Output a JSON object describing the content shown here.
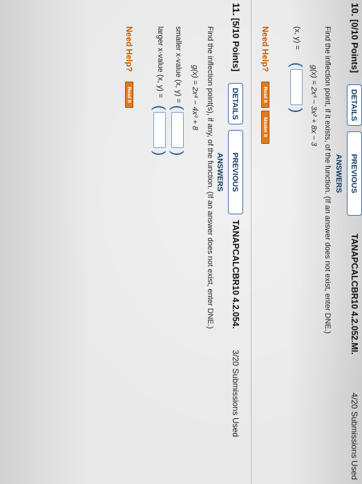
{
  "q10": {
    "number": "10.",
    "points": "[0/10 Points]",
    "details_label": "DETAILS",
    "prev_label": "PREVIOUS ANSWERS",
    "code": "TANAPCALCBR10 4.2.052.MI.",
    "submissions": "4/20 Submissions Used",
    "question": "Find the inflection point, if it exists, of the function. (If an answer does not exist, enter DNE.)",
    "function": "g(x) = 2x³ − 3x² + 8x − 3",
    "answer_label": "(x, y) =",
    "need_help": "Need Help?",
    "read_it": "Read It",
    "master_it": "Master It"
  },
  "q11": {
    "number": "11.",
    "points": "[5/10 Points]",
    "details_label": "DETAILS",
    "prev_label": "PREVIOUS ANSWERS",
    "code": "TANAPCALCBR10 4.2.054.",
    "submissions": "3/20 Submissions Used",
    "question": "Find the inflection point(s), if any, of the function. (If an answer does not exist, enter DNE.)",
    "function": "g(x) = 2x⁴ − 4x³ + 8",
    "smaller_label": "smaller x-value (x, y) =",
    "larger_label": "larger x-value (x, y) =",
    "need_help": "Need Help?",
    "read_it": "Read It"
  },
  "colors": {
    "button_border": "#3b6ea5",
    "help_orange": "#c65a00",
    "help_button": "#e07a1f",
    "paren_blue": "#1f5f9f"
  }
}
